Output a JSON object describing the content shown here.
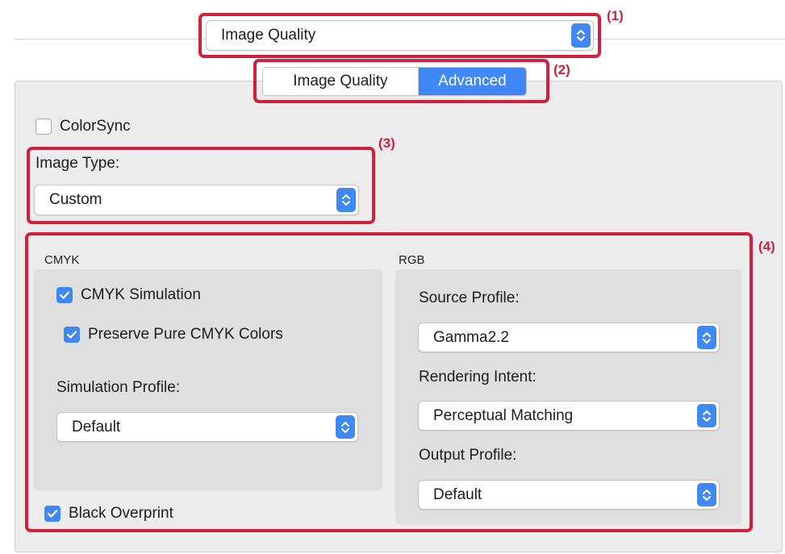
{
  "header": {
    "preset_select": {
      "value": "Image Quality"
    }
  },
  "tabs": {
    "items": [
      "Image Quality",
      "Advanced"
    ],
    "selected": "Advanced"
  },
  "annotations": {
    "a1": "(1)",
    "a2": "(2)",
    "a3": "(3)",
    "a4": "(4)"
  },
  "colorsync": {
    "label": "ColorSync",
    "checked": false
  },
  "image_type": {
    "label": "Image Type:",
    "value": "Custom"
  },
  "cmyk": {
    "title": "CMYK",
    "simulation": {
      "label": "CMYK Simulation",
      "checked": true
    },
    "preserve": {
      "label": "Preserve Pure CMYK Colors",
      "checked": true
    },
    "simulation_profile": {
      "label": "Simulation Profile:",
      "value": "Default"
    }
  },
  "rgb": {
    "title": "RGB",
    "source_profile": {
      "label": "Source Profile:",
      "value": "Gamma2.2"
    },
    "rendering_intent": {
      "label": "Rendering Intent:",
      "value": "Perceptual Matching"
    },
    "output_profile": {
      "label": "Output Profile:",
      "value": "Default"
    }
  },
  "black_overprint": {
    "label": "Black Overprint",
    "checked": true
  },
  "colors": {
    "accent": "#3f88f5",
    "annotation": "#d0203e",
    "panel": "#ececec"
  }
}
